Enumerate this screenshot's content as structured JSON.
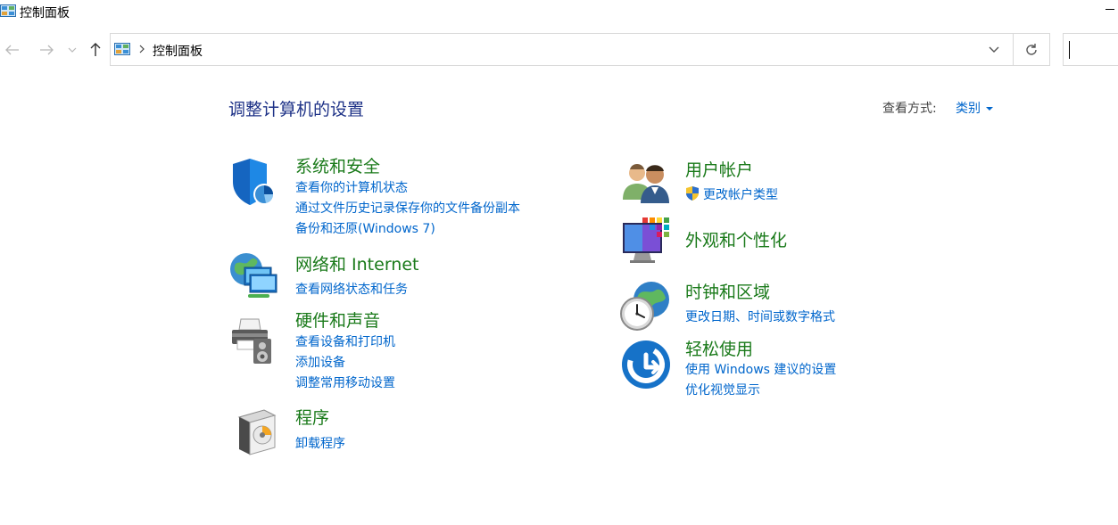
{
  "window": {
    "title": "控制面板"
  },
  "address": {
    "path": "控制面板"
  },
  "search": {
    "placeholder": ""
  },
  "header": {
    "title": "调整计算机的设置",
    "view_by_label": "查看方式:",
    "view_by_value": "类别"
  },
  "categories": {
    "system_security": {
      "title": "系统和安全",
      "links": [
        "查看你的计算机状态",
        "通过文件历史记录保存你的文件备份副本",
        "备份和还原(Windows 7)"
      ]
    },
    "network": {
      "title": "网络和 Internet",
      "links": [
        "查看网络状态和任务"
      ]
    },
    "hardware": {
      "title": "硬件和声音",
      "links": [
        "查看设备和打印机",
        "添加设备",
        "调整常用移动设置"
      ]
    },
    "programs": {
      "title": "程序",
      "links": [
        "卸载程序"
      ]
    },
    "user_accounts": {
      "title": "用户帐户",
      "links": [
        "更改帐户类型"
      ]
    },
    "appearance": {
      "title": "外观和个性化",
      "links": []
    },
    "clock_region": {
      "title": "时钟和区域",
      "links": [
        "更改日期、时间或数字格式"
      ]
    },
    "ease_of_access": {
      "title": "轻松使用",
      "links": [
        "使用 Windows 建议的设置",
        "优化视觉显示"
      ]
    }
  },
  "colors": {
    "heading": "#1e3287",
    "category_title": "#1a7a1a",
    "link": "#0066cc"
  }
}
